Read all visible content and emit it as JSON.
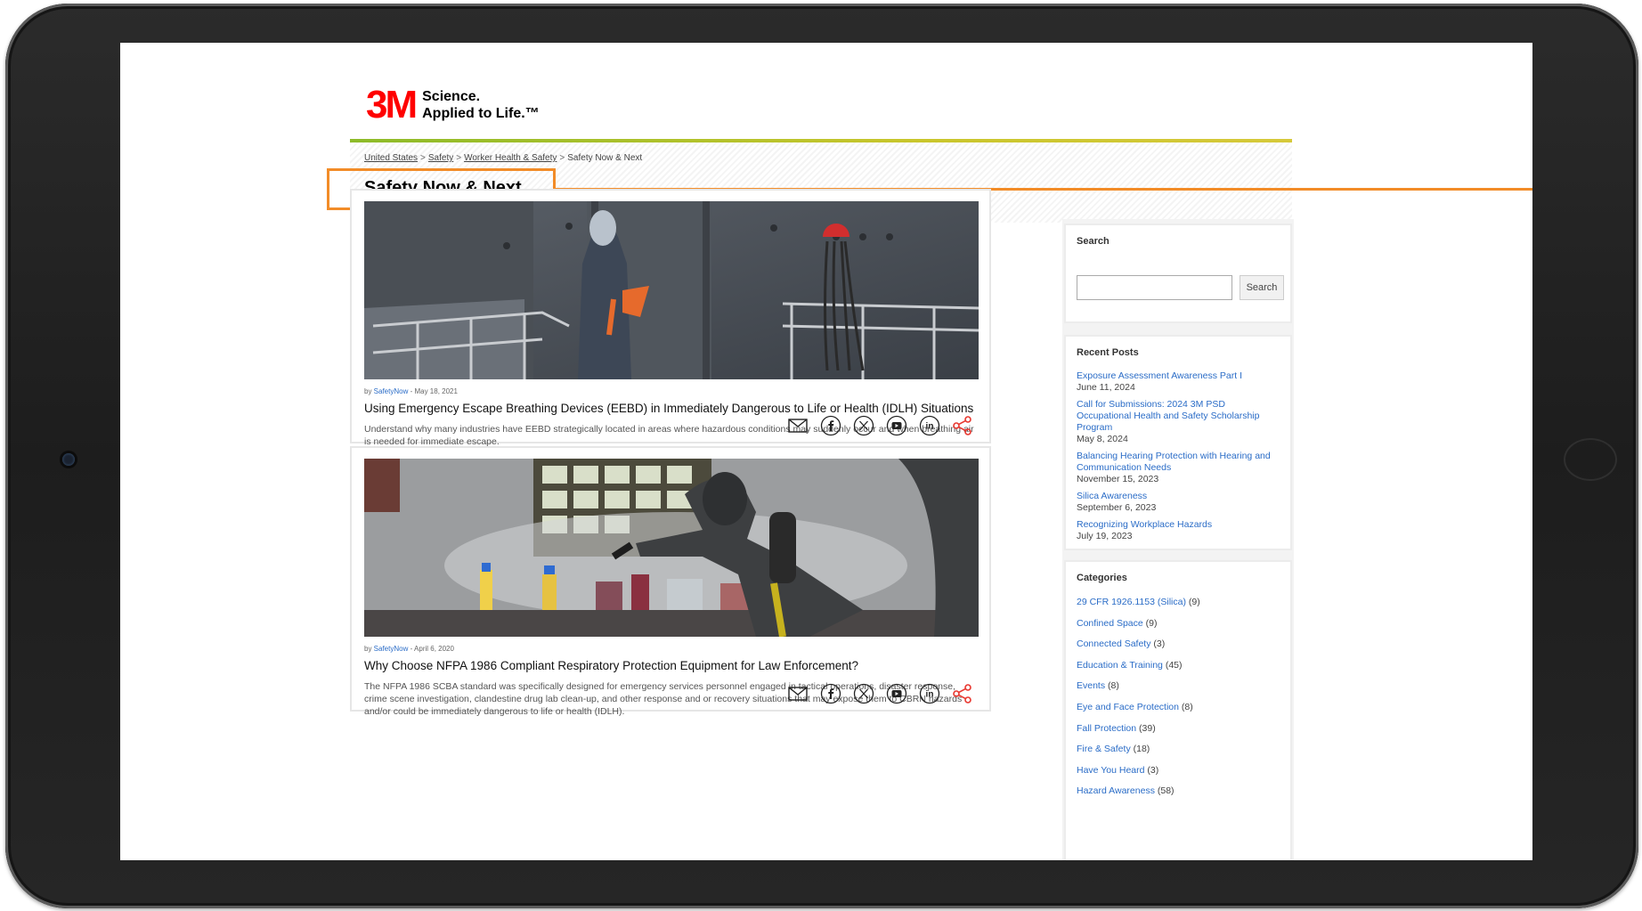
{
  "brand": {
    "logo": "3M",
    "tagline_line1": "Science.",
    "tagline_line2": "Applied to Life.™"
  },
  "breadcrumb": [
    "United States",
    "Safety",
    "Worker Health & Safety",
    "Safety Now & Next"
  ],
  "page_title": "Safety Now & Next",
  "posts": [
    {
      "author": "SafetyNow",
      "date": " - May 18, 2021",
      "by": "by ",
      "title": "Using Emergency Escape Breathing Devices (EEBD) in Immediately Dangerous to Life or Health (IDLH) Situations",
      "excerpt": "Understand why many industries have EEBD strategically located in areas where hazardous conditions may suddenly occur and when breathing air is needed for immediate escape.",
      "image": "worker-in-coverall-escape-hood-icon"
    },
    {
      "author": "SafetyNow",
      "date": " - April 6, 2020",
      "by": "by ",
      "title": "Why Choose NFPA 1986 Compliant Respiratory Protection Equipment for Law Enforcement?",
      "excerpt": "The NFPA 1986 SCBA standard was specifically designed for emergency services personnel engaged in tactical operations, disaster response, crime scene investigation, clandestine drug lab clean-up, and other response and or recovery situations that may expose them to CBRN hazards and/or could be immediately dangerous to life or health (IDLH).",
      "image": "hazmat-responder-drug-lab-icon"
    }
  ],
  "share_icons": [
    "email-icon",
    "facebook-icon",
    "x-icon",
    "youtube-icon",
    "linkedin-icon",
    "share-icon"
  ],
  "sidebar": {
    "search": {
      "heading": "Search",
      "button": "Search",
      "value": ""
    },
    "recent_posts": {
      "heading": "Recent Posts",
      "items": [
        {
          "title": "Exposure Assessment Awareness Part I",
          "date": "June 11, 2024"
        },
        {
          "title": "Call for Submissions: 2024 3M PSD Occupational Health and Safety Scholarship Program",
          "date": "May 8, 2024"
        },
        {
          "title": "Balancing Hearing Protection with Hearing and Communication Needs",
          "date": "November 15, 2023"
        },
        {
          "title": "Silica Awareness",
          "date": "September 6, 2023"
        },
        {
          "title": "Recognizing Workplace Hazards",
          "date": "July 19, 2023"
        }
      ]
    },
    "categories": {
      "heading": "Categories",
      "items": [
        {
          "name": "29 CFR 1926.1153 (Silica)",
          "count": " (9)"
        },
        {
          "name": "Confined Space",
          "count": " (9)"
        },
        {
          "name": "Connected Safety",
          "count": " (3)"
        },
        {
          "name": "Education & Training",
          "count": " (45)"
        },
        {
          "name": "Events",
          "count": " (8)"
        },
        {
          "name": "Eye and Face Protection",
          "count": " (8)"
        },
        {
          "name": "Fall Protection",
          "count": " (39)"
        },
        {
          "name": "Fire & Safety",
          "count": " (18)"
        },
        {
          "name": "Have You Heard",
          "count": " (3)"
        },
        {
          "name": "Hazard Awareness",
          "count": " (58)"
        }
      ]
    }
  },
  "colors": {
    "brand_red": "#ff0000",
    "link_blue": "#2a6cc7",
    "highlight_orange": "#f28c28",
    "share_red": "#e8362e"
  }
}
